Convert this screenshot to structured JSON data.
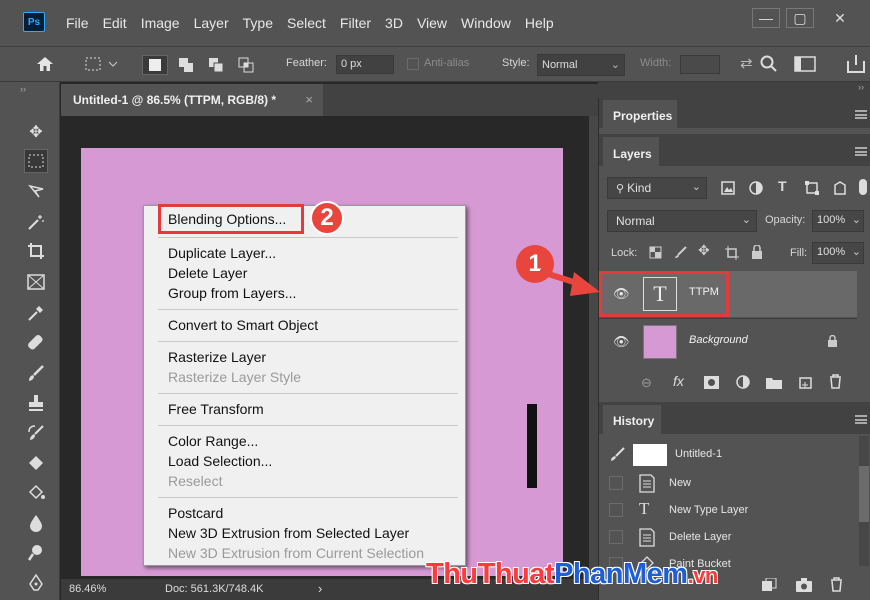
{
  "app": {
    "logo": "Ps"
  },
  "menu": [
    "File",
    "Edit",
    "Image",
    "Layer",
    "Type",
    "Select",
    "Filter",
    "3D",
    "View",
    "Window",
    "Help"
  ],
  "window_controls": {
    "minimize": "—",
    "restore": "▢",
    "close": "✕"
  },
  "options_bar": {
    "feather_label": "Feather:",
    "feather_value": "0 px",
    "antialias_label": "Anti-alias",
    "style_label": "Style:",
    "style_value": "Normal",
    "width_label": "Width:"
  },
  "document": {
    "tab_title": "Untitled-1 @ 86.5% (TTPM, RGB/8) *",
    "close": "×",
    "zoom": "86.46%",
    "doc_info": "Doc: 561.3K/748.4K",
    "status_arrow": "›",
    "canvas_color": "#d699d4"
  },
  "context_menu": {
    "items": [
      {
        "label": "Blending Options...",
        "enabled": true
      },
      {
        "label": "Duplicate Layer...",
        "enabled": true
      },
      {
        "label": "Delete Layer",
        "enabled": true
      },
      {
        "label": "Group from Layers...",
        "enabled": true
      },
      {
        "label": "Convert to Smart Object",
        "enabled": true
      },
      {
        "label": "Rasterize Layer",
        "enabled": true
      },
      {
        "label": "Rasterize Layer Style",
        "enabled": false
      },
      {
        "label": "Free Transform",
        "enabled": true
      },
      {
        "label": "Color Range...",
        "enabled": true
      },
      {
        "label": "Load Selection...",
        "enabled": true
      },
      {
        "label": "Reselect",
        "enabled": false
      },
      {
        "label": "Postcard",
        "enabled": true
      },
      {
        "label": "New 3D Extrusion from Selected Layer",
        "enabled": true
      },
      {
        "label": "New 3D Extrusion from Current Selection",
        "enabled": false
      }
    ]
  },
  "annotations": {
    "step1": "1",
    "step2": "2",
    "highlight_color": "#e33a3a"
  },
  "properties_panel": {
    "title": "Properties"
  },
  "layers_panel": {
    "title": "Layers",
    "filter_kind": "Kind",
    "blend_mode": "Normal",
    "opacity_label": "Opacity:",
    "opacity_value": "100%",
    "lock_label": "Lock:",
    "fill_label": "Fill:",
    "fill_value": "100%",
    "layers": [
      {
        "name": "TTPM",
        "type": "text",
        "selected": true
      },
      {
        "name": "Background",
        "type": "raster",
        "locked": true
      }
    ]
  },
  "history_panel": {
    "title": "History",
    "snapshot": "Untitled-1",
    "states": [
      "New",
      "New Type Layer",
      "Delete Layer",
      "Paint Bucket"
    ]
  },
  "watermark": {
    "part1": "ThuThuat",
    "part2": "PhanMem",
    "part3": ".vn"
  }
}
